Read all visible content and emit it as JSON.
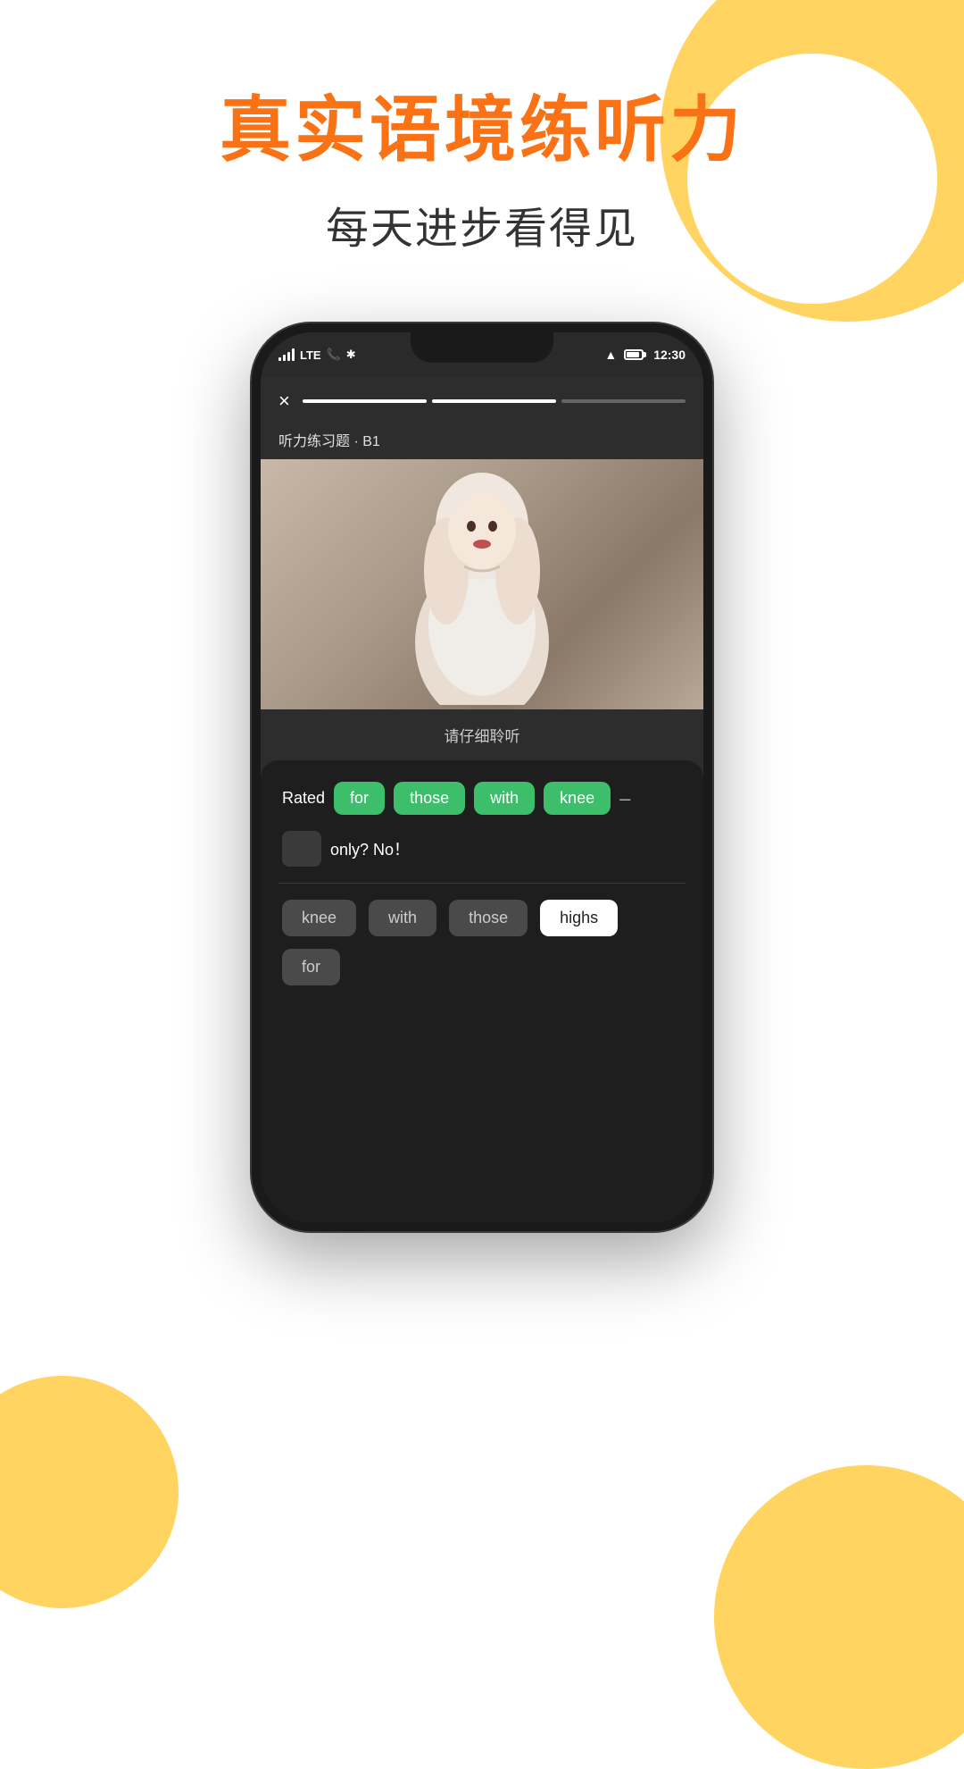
{
  "decorative": {
    "circles": [
      "top-right",
      "bottom-left",
      "bottom-right"
    ]
  },
  "header": {
    "main_title": "真实语境练听力",
    "sub_title": "每天进步看得见"
  },
  "phone": {
    "status_bar": {
      "time": "12:30",
      "lte_label": "LTE"
    },
    "top_bar": {
      "close_label": "×",
      "progress_segments": 3,
      "progress_active_index": 0
    },
    "exercise_label": "听力练习题 · B1",
    "listen_text": "请仔细聆听",
    "sentence": {
      "prefix": "Rated",
      "words": [
        "for",
        "those",
        "with",
        "knee"
      ],
      "dash": "–",
      "blank": "",
      "suffix_text": "only?  No！"
    },
    "options": [
      {
        "word": "knee",
        "style": "gray"
      },
      {
        "word": "with",
        "style": "gray"
      },
      {
        "word": "those",
        "style": "gray"
      },
      {
        "word": "highs",
        "style": "white"
      },
      {
        "word": "for",
        "style": "gray"
      }
    ]
  }
}
